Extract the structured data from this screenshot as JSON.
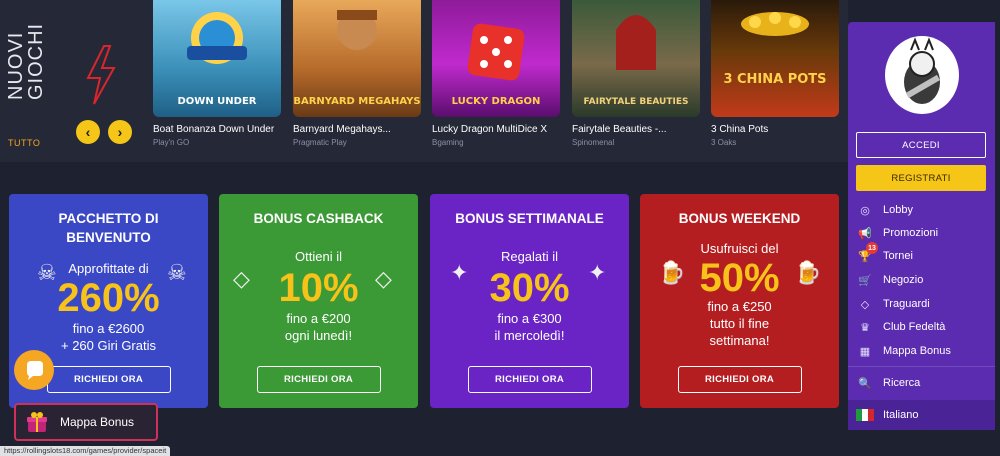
{
  "new_games": {
    "title": "NUOVI\nGIOCHI",
    "see_all": "TUTTO",
    "prev_label": "‹",
    "next_label": "›",
    "games": [
      {
        "title": "Boat Bonanza Down Under",
        "provider": "Play'n GO",
        "thumb_text": "DOWN UNDER"
      },
      {
        "title": "Barnyard Megahays...",
        "provider": "Pragmatic Play",
        "thumb_text": "BARNYARD MEGAHAYS"
      },
      {
        "title": "Lucky Dragon MultiDice X",
        "provider": "Bgaming",
        "thumb_text": "LUCKY DRAGON"
      },
      {
        "title": "Fairytale Beauties -...",
        "provider": "Spinomenal",
        "thumb_text": "FAIRYTALE BEAUTIES"
      },
      {
        "title": "3 China Pots",
        "provider": "3 Oaks",
        "thumb_text": "3 CHINA POTS"
      }
    ]
  },
  "bonuses": [
    {
      "title": "PACCHETTO DI BENVENUTO",
      "intro": "Approfittate di",
      "big": "260%",
      "line1": "fino a €2600",
      "line2": "+ 260 Giri Gratis",
      "button": "RICHIEDI ORA"
    },
    {
      "title": "BONUS CASHBACK",
      "intro": "Ottieni il",
      "big": "10%",
      "line1": "fino a €200",
      "line2": "ogni lunedì!",
      "button": "RICHIEDI ORA"
    },
    {
      "title": "BONUS SETTIMANALE",
      "intro": "Regalati il",
      "big": "30%",
      "line1": "fino a €300",
      "line2": "il mercoledì!",
      "button": "RICHIEDI ORA"
    },
    {
      "title": "BONUS WEEKEND",
      "intro": "Usufruisci del",
      "big": "50%",
      "line1": "fino a €250",
      "line2": "tutto il fine",
      "line3": "settimana!",
      "button": "RICHIEDI ORA"
    }
  ],
  "sidebar": {
    "login": "ACCEDI",
    "register": "REGISTRATI",
    "menu": [
      {
        "label": "Lobby",
        "icon": "lobby-icon"
      },
      {
        "label": "Promozioni",
        "icon": "megaphone-icon"
      },
      {
        "label": "Tornei",
        "icon": "trophy-icon",
        "badge": "13"
      },
      {
        "label": "Negozio",
        "icon": "cart-icon"
      },
      {
        "label": "Traguardi",
        "icon": "diamond-icon"
      },
      {
        "label": "Club Fedeltà",
        "icon": "crown-icon"
      },
      {
        "label": "Mappa Bonus",
        "icon": "map-icon"
      }
    ],
    "search": "Ricerca",
    "language": "Italiano"
  },
  "widgets": {
    "mappa_bonus": "Mappa Bonus"
  },
  "status_url": "https://rollingslots18.com/games/provider/spaceit",
  "colors": {
    "page_bg": "#1e2130",
    "accent_yellow": "#f7c21a",
    "sidebar_purple": "#5b2bb0",
    "card_blue": "#3b48c6",
    "card_green": "#3b9a36",
    "card_purple": "#6a23c4",
    "card_red": "#b51e20"
  }
}
